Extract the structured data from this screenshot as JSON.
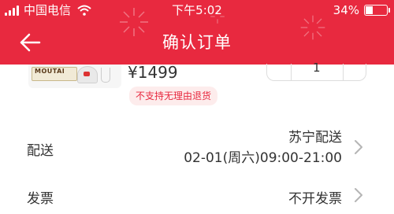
{
  "status_bar": {
    "carrier": "中国电信",
    "time": "下午5:02",
    "battery": "34%",
    "battery_level": 0.34
  },
  "header": {
    "title": "确认订单",
    "background": "#e8293f"
  },
  "product": {
    "brand_text": "MOUTAI",
    "price": "¥1499",
    "quantity": "1",
    "tag": "不支持无理由退货"
  },
  "delivery": {
    "label": "配送",
    "method": "苏宁配送",
    "time_slot": "02-01(周六)09:00-21:00"
  },
  "invoice": {
    "label": "发票",
    "value": "不开发票"
  },
  "colors": {
    "accent": "#e8293f",
    "tag_bg": "#fdecec",
    "text": "#333333"
  }
}
